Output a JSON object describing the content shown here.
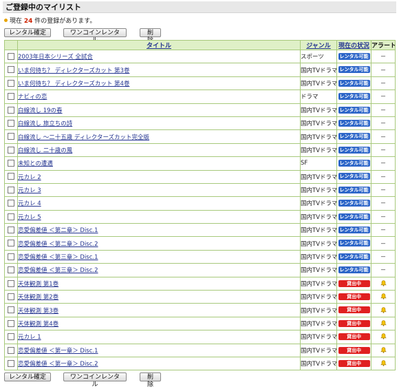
{
  "page": {
    "title": "ご登録中のマイリスト",
    "count_prefix": "現在 ",
    "count": "24",
    "count_suffix": " 件の登録があります。"
  },
  "buttons": {
    "rental_confirm": "レンタル確定",
    "one_coin": "ワンコインレンタル",
    "delete": "削除"
  },
  "table": {
    "headers": {
      "title": "タイトル",
      "genre": "ジャンル",
      "status": "現在の状況",
      "alert": "アラート"
    },
    "rows": [
      {
        "title": "2003年日本シリーズ 全試合",
        "genre": "スポーツ",
        "status": "レンタル可能",
        "alert": "－"
      },
      {
        "title": "いま何待ち？ ディレクターズカット 第3巻",
        "genre": "国内TVドラマ",
        "status": "レンタル可能",
        "alert": "－"
      },
      {
        "title": "いま何待ち？ ディレクターズカット 第4巻",
        "genre": "国内TVドラマ",
        "status": "レンタル可能",
        "alert": "－"
      },
      {
        "title": "ナビィの恋",
        "genre": "ドラマ",
        "status": "レンタル可能",
        "alert": "－"
      },
      {
        "title": "白線流し 19の春",
        "genre": "国内TVドラマ",
        "status": "レンタル可能",
        "alert": "－"
      },
      {
        "title": "白線流し 旅立ちの詩",
        "genre": "国内TVドラマ",
        "status": "レンタル可能",
        "alert": "－"
      },
      {
        "title": "白線流し ～二十五歳 ディレクターズカット完全版",
        "genre": "国内TVドラマ",
        "status": "レンタル可能",
        "alert": "－"
      },
      {
        "title": "白線流し 二十歳の風",
        "genre": "国内TVドラマ",
        "status": "レンタル可能",
        "alert": "－"
      },
      {
        "title": "未知との遭遇",
        "genre": "SF",
        "status": "レンタル可能",
        "alert": "－"
      },
      {
        "title": "元カレ 2",
        "genre": "国内TVドラマ",
        "status": "レンタル可能",
        "alert": "－"
      },
      {
        "title": "元カレ 3",
        "genre": "国内TVドラマ",
        "status": "レンタル可能",
        "alert": "－"
      },
      {
        "title": "元カレ 4",
        "genre": "国内TVドラマ",
        "status": "レンタル可能",
        "alert": "－"
      },
      {
        "title": "元カレ 5",
        "genre": "国内TVドラマ",
        "status": "レンタル可能",
        "alert": "－"
      },
      {
        "title": "恋愛偏差値 ＜第二章＞ Disc.1",
        "genre": "国内TVドラマ",
        "status": "レンタル可能",
        "alert": "－"
      },
      {
        "title": "恋愛偏差値 ＜第二章＞ Disc.2",
        "genre": "国内TVドラマ",
        "status": "レンタル可能",
        "alert": "－"
      },
      {
        "title": "恋愛偏差値 ＜第三章＞ Disc.1",
        "genre": "国内TVドラマ",
        "status": "レンタル可能",
        "alert": "－"
      },
      {
        "title": "恋愛偏差値 ＜第三章＞ Disc.2",
        "genre": "国内TVドラマ",
        "status": "レンタル可能",
        "alert": "－"
      },
      {
        "title": "天体観測 第1巻",
        "genre": "国内TVドラマ",
        "status": "貸出中",
        "alert": "bell-icon"
      },
      {
        "title": "天体観測 第2巻",
        "genre": "国内TVドラマ",
        "status": "貸出中",
        "alert": "bell-icon"
      },
      {
        "title": "天体観測 第3巻",
        "genre": "国内TVドラマ",
        "status": "貸出中",
        "alert": "bell-icon"
      },
      {
        "title": "天体観測 第4巻",
        "genre": "国内TVドラマ",
        "status": "貸出中",
        "alert": "bell-icon"
      },
      {
        "title": "元カレ 1",
        "genre": "国内TVドラマ",
        "status": "貸出中",
        "alert": "bell-icon"
      },
      {
        "title": "恋愛偏差値 ＜第一章＞ Disc.1",
        "genre": "国内TVドラマ",
        "status": "貸出中",
        "alert": "bell-icon"
      },
      {
        "title": "恋愛偏差値 ＜第一章＞ Disc.2",
        "genre": "国内TVドラマ",
        "status": "貸出中",
        "alert": "bell-icon"
      }
    ]
  },
  "colors": {
    "available": "#2d66c8",
    "rented_out": "#e02020",
    "header_bg": "#dff0c7",
    "border": "#a7c97b"
  }
}
